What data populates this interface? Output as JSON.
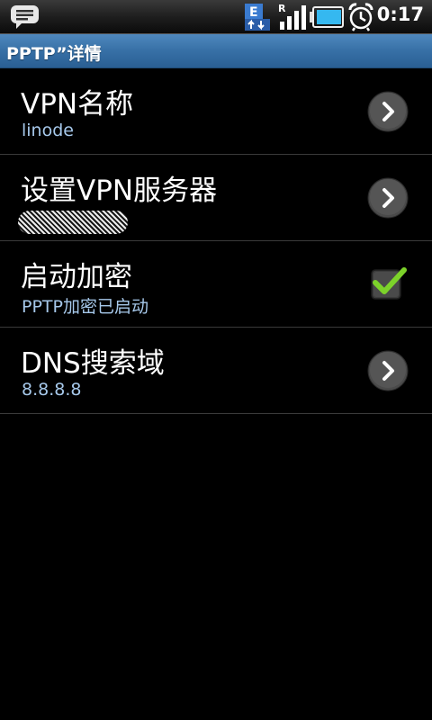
{
  "status_bar": {
    "time": "0:17",
    "network_letter": "R",
    "icons": [
      "message-icon",
      "edge-data-icon",
      "signal-icon",
      "battery-icon",
      "alarm-icon"
    ]
  },
  "header": {
    "title": "PPTP”详情"
  },
  "settings": [
    {
      "title": "VPN名称",
      "subtitle": "linode",
      "control": "chevron"
    },
    {
      "title": "设置VPN服务器",
      "subtitle": "",
      "control": "chevron"
    },
    {
      "title": "启动加密",
      "subtitle": "PPTP加密已启动",
      "control": "checkbox",
      "checked": true
    },
    {
      "title": "DNS搜索域",
      "subtitle": "8.8.8.8",
      "control": "chevron"
    }
  ],
  "colors": {
    "title_bar": "#3770a6",
    "subtitle_text": "#a6c8ea",
    "check_green": "#7cd22a"
  }
}
